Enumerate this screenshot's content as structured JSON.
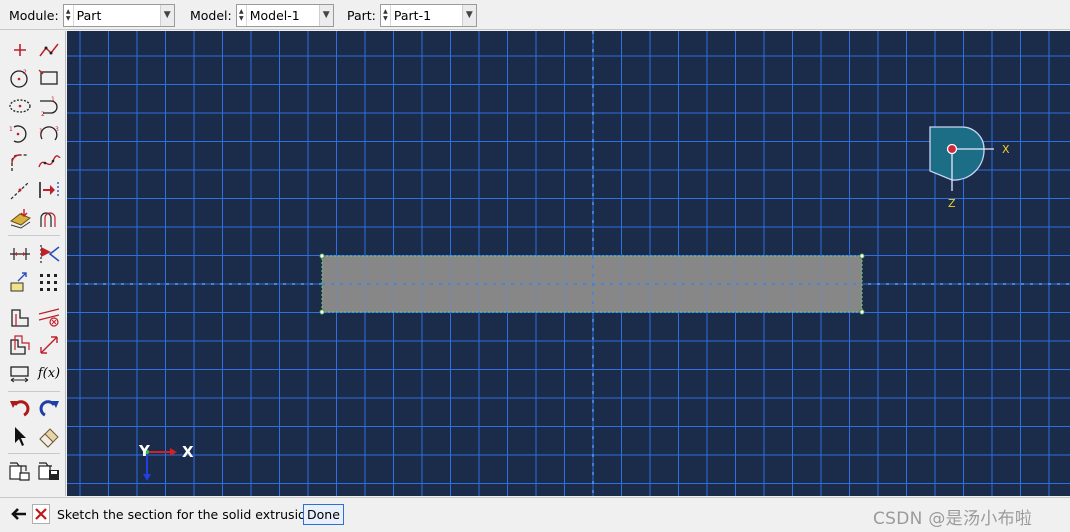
{
  "context_bar": {
    "module": {
      "label": "Module:",
      "value": "Part"
    },
    "model": {
      "label": "Model:",
      "value": "Model-1"
    },
    "part": {
      "label": "Part:",
      "value": "Part-1"
    }
  },
  "toolbox": {
    "tools": [
      "create-isolated-point-icon",
      "create-lines-connected-icon",
      "create-circle-icon",
      "create-rectangle-icon",
      "create-ellipse-icon",
      "create-arc-tangent-icon",
      "create-arc-center-icon",
      "create-arc-three-points-icon",
      "create-fillet-icon",
      "create-spline-icon",
      "create-construction-line-icon",
      "add-constraint-icon",
      "sketch-options-icon",
      "offset-curves-icon",
      "dimension-icon",
      "edit-dimension-icon",
      "translate-icon",
      "linear-pattern-icon",
      "split-icon",
      "fillet-trim-icon",
      "copy-icon",
      "move-vertex-icon",
      "parameter-manager-icon",
      "fx-parameter-icon",
      "undo-icon",
      "redo-icon",
      "select-pointer-icon",
      "eraser-icon",
      "open-sketch-icon",
      "save-sketch-icon"
    ],
    "fx_label": "f(x)"
  },
  "viewport": {
    "background": "#1b2b4a",
    "grid_color": "#2f6fe0",
    "profile_fill": "#878787",
    "triad_label_x": "X",
    "triad_label_z": "Z",
    "axis_label_y": "Y",
    "axis_label_x": "X"
  },
  "prompt": {
    "text": "Sketch the section for the solid extrusion",
    "done_label": "Done",
    "watermark": "CSDN @是汤小布啦"
  }
}
